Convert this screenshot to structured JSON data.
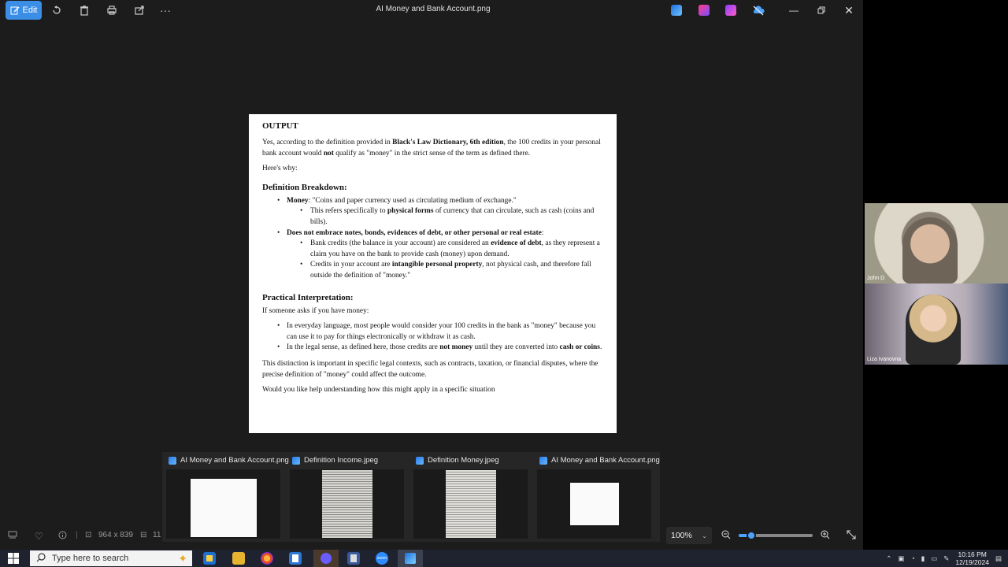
{
  "titlebar": {
    "edit_label": "Edit",
    "title": "AI Money and Bank Account.png"
  },
  "document": {
    "heading": "OUTPUT",
    "intro_prefix": "Yes, according to the definition provided in ",
    "intro_bold": "Black's Law Dictionary, 6th edition",
    "intro_mid": ", the 100 credits in your personal bank account would ",
    "intro_not": "not",
    "intro_suffix": " qualify as \"money\" in the strict sense of the term as defined there.",
    "why": "Here's why:",
    "section1": "Definition Breakdown:",
    "money_label": "Money",
    "money_text": ": \"Coins and paper currency used as circulating medium of exchange.\"",
    "money_sub_prefix": "This refers specifically to ",
    "money_sub_bold": "physical forms",
    "money_sub_suffix": " of currency that can circulate, such as cash (coins and bills).",
    "notes_bold": "Does not embrace notes, bonds, evidences of debt, or other personal or real estate",
    "notes_suffix": ":",
    "notes_sub1_prefix": "Bank credits (the balance in your account) are considered an ",
    "notes_sub1_bold": "evidence of debt",
    "notes_sub1_suffix": ", as they represent a claim you have on the bank to provide cash (money) upon demand.",
    "notes_sub2_prefix": "Credits in your account are ",
    "notes_sub2_bold": "intangible personal property",
    "notes_sub2_suffix": ", not physical cash, and therefore fall outside the definition of \"money.\"",
    "section2": "Practical Interpretation:",
    "if_asks": "If someone asks if you have money:",
    "everyday": "In everyday language, most people would consider your 100 credits in the bank as \"money\" because you can use it to pay for things electronically or withdraw it as cash.",
    "legal_prefix": "In the legal sense, as defined here, those credits are ",
    "legal_bold": "not money",
    "legal_mid": " until they are converted into ",
    "legal_bold2": "cash or coins",
    "legal_suffix": ".",
    "distinction": "This distinction is important in specific legal contexts, such as contracts, taxation, or financial disputes, where the precise definition of \"money\" could affect the outcome.",
    "closing": "Would you like help understanding how this might apply in a specific situation"
  },
  "thumbnails": [
    {
      "title": "AI Money and Bank Account.png"
    },
    {
      "title": "Definition Income.jpeg"
    },
    {
      "title": "Definition Money.jpeg"
    },
    {
      "title": "AI Money and Bank Account.png"
    }
  ],
  "bottombar": {
    "dimensions": "964 x 839",
    "size_partial": "11",
    "zoom": "100%",
    "zoom_fraction": 0.17
  },
  "participants": [
    {
      "name": "John D"
    },
    {
      "name": "Liza Ivanovna"
    }
  ],
  "taskbar": {
    "search_placeholder": "Type here to search",
    "time": "10:16 PM",
    "date": "12/19/2024"
  }
}
